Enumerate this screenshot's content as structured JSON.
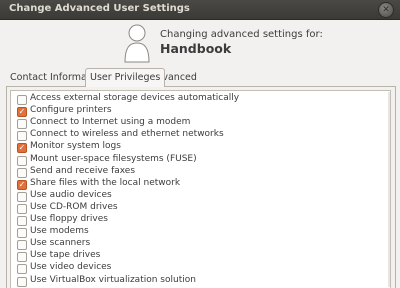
{
  "window": {
    "title": "Change Advanced User Settings",
    "close_glyph": "✕"
  },
  "header": {
    "avatar_icon": "user-silhouette-icon",
    "changing_label": "Changing advanced settings for:",
    "user_name": "Handbook"
  },
  "tabs": [
    {
      "label": "Contact Information",
      "active": false
    },
    {
      "label": "User Privileges",
      "active": true
    },
    {
      "label": "Advanced",
      "active": false
    }
  ],
  "privileges": [
    {
      "label": "Access external storage devices automatically",
      "checked": false
    },
    {
      "label": "Configure printers",
      "checked": true
    },
    {
      "label": "Connect to Internet using a modem",
      "checked": false
    },
    {
      "label": "Connect to wireless and ethernet networks",
      "checked": false
    },
    {
      "label": "Monitor system logs",
      "checked": true
    },
    {
      "label": "Mount user-space filesystems (FUSE)",
      "checked": false
    },
    {
      "label": "Send and receive faxes",
      "checked": false
    },
    {
      "label": "Share files with the local network",
      "checked": true
    },
    {
      "label": "Use audio devices",
      "checked": false
    },
    {
      "label": "Use CD-ROM drives",
      "checked": false
    },
    {
      "label": "Use floppy drives",
      "checked": false
    },
    {
      "label": "Use modems",
      "checked": false
    },
    {
      "label": "Use scanners",
      "checked": false
    },
    {
      "label": "Use tape drives",
      "checked": false
    },
    {
      "label": "Use video devices",
      "checked": false
    },
    {
      "label": "Use VirtualBox virtualization solution",
      "checked": false
    }
  ],
  "colors": {
    "checkbox_accent": "#e2703a",
    "titlebar": "#3b3a36"
  }
}
